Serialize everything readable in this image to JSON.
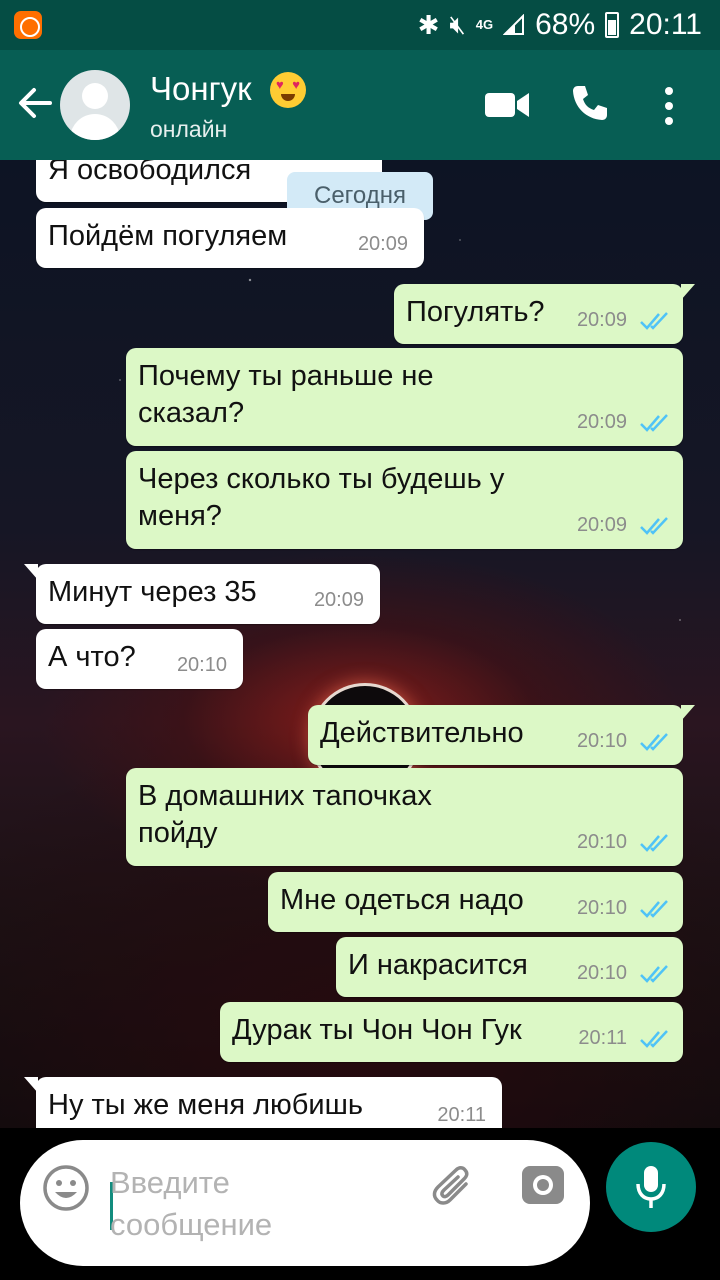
{
  "status_bar": {
    "battery": "68%",
    "time": "20:11",
    "network": "4G"
  },
  "header": {
    "contact_name": "Чонгук",
    "contact_status": "онлайн",
    "icons": [
      "back-icon",
      "avatar",
      "heart-eyes-emoji",
      "video-call-icon",
      "phone-call-icon",
      "more-menu-icon"
    ]
  },
  "chat": {
    "date_divider": "Сегодня",
    "messages": [
      {
        "dir": "in",
        "text": "Я освободился",
        "time": ""
      },
      {
        "dir": "in",
        "text": "Пойдём погуляем",
        "time": "20:09"
      },
      {
        "dir": "out",
        "text": "Погулять?",
        "time": "20:09"
      },
      {
        "dir": "out",
        "text": "Почему ты раньше не сказал?",
        "lines": [
          "Почему ты раньше не",
          "сказал?"
        ],
        "time": "20:09"
      },
      {
        "dir": "out",
        "text": "Через сколько ты будешь у меня?",
        "lines": [
          "Через сколько ты будешь у",
          "меня?"
        ],
        "time": "20:09"
      },
      {
        "dir": "in",
        "text": "Минут через 35",
        "time": "20:09"
      },
      {
        "dir": "in",
        "text": "А что?",
        "time": "20:10"
      },
      {
        "dir": "out",
        "text": "Действительно",
        "time": "20:10"
      },
      {
        "dir": "out",
        "text": "В домашних тапочках пойду",
        "lines": [
          "В домашних тапочках",
          "пойду"
        ],
        "time": "20:10"
      },
      {
        "dir": "out",
        "text": "Мне одеться надо",
        "time": "20:10"
      },
      {
        "dir": "out",
        "text": "И накрасится",
        "time": "20:10"
      },
      {
        "dir": "out",
        "text": "Дурак ты Чон Чон Гук",
        "time": "20:11"
      },
      {
        "dir": "in",
        "text": "Ну ты же меня любишь",
        "time": "20:11"
      }
    ]
  },
  "composer": {
    "placeholder": "Введите сообщение",
    "value": ""
  },
  "colors": {
    "header": "#075e54",
    "status_bar": "#054d44",
    "incoming_bubble": "#ffffff",
    "outgoing_bubble": "#dcf8c6",
    "read_ticks": "#4fc3f7",
    "mic_button": "#00897b"
  }
}
